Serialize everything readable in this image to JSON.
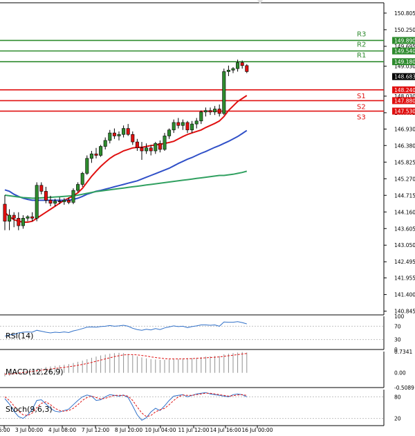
{
  "chart_data": {
    "type": "candlestick",
    "main": {
      "y_ticks": [
        "150.805",
        "150.250",
        "149.695",
        "149.030",
        "148.030",
        "147.475",
        "146.930",
        "146.380",
        "145.825",
        "145.270",
        "144.715",
        "144.160",
        "143.605",
        "143.050",
        "142.495",
        "141.955",
        "141.400",
        "140.845"
      ],
      "y_tick_values": [
        150.805,
        150.25,
        149.695,
        149.03,
        148.03,
        147.475,
        146.93,
        146.38,
        145.825,
        145.27,
        144.715,
        144.16,
        143.605,
        143.05,
        142.495,
        141.955,
        141.4,
        140.845
      ],
      "ylim": [
        140.72,
        151.15
      ],
      "x_ticks": [
        "6:00",
        "3 Jul 00:00",
        "4 Jul 08:00",
        "7 Jul 12:00",
        "8 Jul 20:00",
        "10 Jul 04:00",
        "11 Jul 12:00",
        "14 Jul 16:00",
        "16 Jul 00:00"
      ],
      "candles": [
        {
          "o": 144.42,
          "h": 144.72,
          "l": 143.55,
          "c": 143.85
        },
        {
          "o": 143.85,
          "h": 144.25,
          "l": 143.55,
          "c": 144.05
        },
        {
          "o": 144.05,
          "h": 144.15,
          "l": 143.65,
          "c": 143.95
        },
        {
          "o": 143.95,
          "h": 144.15,
          "l": 143.55,
          "c": 143.7
        },
        {
          "o": 143.7,
          "h": 144.05,
          "l": 143.6,
          "c": 143.95
        },
        {
          "o": 143.95,
          "h": 144.05,
          "l": 143.85,
          "c": 144.0
        },
        {
          "o": 144.0,
          "h": 144.15,
          "l": 143.85,
          "c": 143.95
        },
        {
          "o": 143.95,
          "h": 145.15,
          "l": 143.85,
          "c": 145.05
        },
        {
          "o": 145.05,
          "h": 145.15,
          "l": 144.75,
          "c": 144.85
        },
        {
          "o": 144.85,
          "h": 145.0,
          "l": 144.45,
          "c": 144.55
        },
        {
          "o": 144.55,
          "h": 144.7,
          "l": 144.35,
          "c": 144.45
        },
        {
          "o": 144.45,
          "h": 144.6,
          "l": 144.35,
          "c": 144.52
        },
        {
          "o": 144.52,
          "h": 144.65,
          "l": 144.42,
          "c": 144.5
        },
        {
          "o": 144.5,
          "h": 144.62,
          "l": 144.4,
          "c": 144.55
        },
        {
          "o": 144.55,
          "h": 144.65,
          "l": 144.42,
          "c": 144.48
        },
        {
          "o": 144.48,
          "h": 144.95,
          "l": 144.42,
          "c": 144.88
        },
        {
          "o": 144.88,
          "h": 145.15,
          "l": 144.82,
          "c": 145.08
        },
        {
          "o": 145.08,
          "h": 145.5,
          "l": 145.0,
          "c": 145.45
        },
        {
          "o": 145.45,
          "h": 146.05,
          "l": 145.4,
          "c": 145.95
        },
        {
          "o": 145.95,
          "h": 146.2,
          "l": 145.8,
          "c": 146.1
        },
        {
          "o": 146.1,
          "h": 146.3,
          "l": 145.95,
          "c": 146.05
        },
        {
          "o": 146.05,
          "h": 146.4,
          "l": 146.0,
          "c": 146.35
        },
        {
          "o": 146.35,
          "h": 146.65,
          "l": 146.25,
          "c": 146.55
        },
        {
          "o": 146.55,
          "h": 146.9,
          "l": 146.45,
          "c": 146.8
        },
        {
          "o": 146.8,
          "h": 146.95,
          "l": 146.6,
          "c": 146.7
        },
        {
          "o": 146.7,
          "h": 146.85,
          "l": 146.55,
          "c": 146.75
        },
        {
          "o": 146.75,
          "h": 147.05,
          "l": 146.65,
          "c": 146.95
        },
        {
          "o": 146.95,
          "h": 147.1,
          "l": 146.7,
          "c": 146.75
        },
        {
          "o": 146.75,
          "h": 146.85,
          "l": 146.4,
          "c": 146.5
        },
        {
          "o": 146.5,
          "h": 146.6,
          "l": 146.2,
          "c": 146.3
        },
        {
          "o": 146.3,
          "h": 146.5,
          "l": 145.9,
          "c": 146.2
        },
        {
          "o": 146.2,
          "h": 146.45,
          "l": 146.1,
          "c": 146.3
        },
        {
          "o": 146.3,
          "h": 146.4,
          "l": 146.05,
          "c": 146.2
        },
        {
          "o": 146.2,
          "h": 146.5,
          "l": 146.1,
          "c": 146.45
        },
        {
          "o": 146.45,
          "h": 146.55,
          "l": 146.15,
          "c": 146.25
        },
        {
          "o": 146.25,
          "h": 146.8,
          "l": 146.2,
          "c": 146.7
        },
        {
          "o": 146.7,
          "h": 146.95,
          "l": 146.6,
          "c": 146.9
        },
        {
          "o": 146.9,
          "h": 147.25,
          "l": 146.8,
          "c": 147.15
        },
        {
          "o": 147.15,
          "h": 147.3,
          "l": 146.95,
          "c": 147.05
        },
        {
          "o": 147.05,
          "h": 147.25,
          "l": 146.9,
          "c": 147.15
        },
        {
          "o": 147.15,
          "h": 147.2,
          "l": 146.8,
          "c": 146.9
        },
        {
          "o": 146.9,
          "h": 147.2,
          "l": 146.8,
          "c": 147.1
        },
        {
          "o": 147.1,
          "h": 147.3,
          "l": 146.95,
          "c": 147.2
        },
        {
          "o": 147.2,
          "h": 147.55,
          "l": 147.1,
          "c": 147.5
        },
        {
          "o": 147.5,
          "h": 147.65,
          "l": 147.35,
          "c": 147.55
        },
        {
          "o": 147.55,
          "h": 147.65,
          "l": 147.4,
          "c": 147.5
        },
        {
          "o": 147.5,
          "h": 147.7,
          "l": 147.4,
          "c": 147.6
        },
        {
          "o": 147.6,
          "h": 147.75,
          "l": 147.35,
          "c": 147.45
        },
        {
          "o": 147.45,
          "h": 148.95,
          "l": 147.4,
          "c": 148.85
        },
        {
          "o": 148.85,
          "h": 149.05,
          "l": 148.7,
          "c": 148.9
        },
        {
          "o": 148.9,
          "h": 149.0,
          "l": 148.8,
          "c": 148.95
        },
        {
          "o": 148.95,
          "h": 149.25,
          "l": 148.85,
          "c": 149.15
        },
        {
          "o": 149.15,
          "h": 149.22,
          "l": 148.95,
          "c": 149.05
        },
        {
          "o": 149.05,
          "h": 149.1,
          "l": 148.8,
          "c": 148.85
        }
      ],
      "moving_averages": [
        {
          "color": "#e01010",
          "values": [
            144.15,
            144.0,
            143.9,
            143.85,
            143.82,
            143.82,
            143.85,
            143.95,
            144.05,
            144.15,
            144.25,
            144.35,
            144.45,
            144.55,
            144.62,
            144.7,
            144.8,
            144.95,
            145.15,
            145.35,
            145.52,
            145.68,
            145.82,
            145.95,
            146.05,
            146.12,
            146.2,
            146.25,
            146.3,
            146.32,
            146.32,
            146.35,
            146.38,
            146.4,
            146.42,
            146.45,
            146.48,
            146.52,
            146.6,
            146.68,
            146.75,
            146.8,
            146.85,
            146.9,
            146.98,
            147.05,
            147.12,
            147.2,
            147.35,
            147.55,
            147.7,
            147.85,
            147.95,
            148.05
          ]
        },
        {
          "color": "#3050c8",
          "values": [
            144.9,
            144.85,
            144.75,
            144.68,
            144.62,
            144.58,
            144.55,
            144.55,
            144.55,
            144.55,
            144.55,
            144.55,
            144.55,
            144.55,
            144.55,
            144.58,
            144.62,
            144.68,
            144.75,
            144.8,
            144.85,
            144.88,
            144.92,
            144.96,
            145.0,
            145.04,
            145.08,
            145.12,
            145.16,
            145.2,
            145.26,
            145.32,
            145.38,
            145.44,
            145.5,
            145.56,
            145.62,
            145.7,
            145.78,
            145.85,
            145.92,
            145.98,
            146.05,
            146.12,
            146.18,
            146.25,
            146.32,
            146.38,
            146.45,
            146.52,
            146.6,
            146.68,
            146.78,
            146.88
          ]
        },
        {
          "color": "#30a060",
          "values": [
            144.72,
            144.7,
            144.68,
            144.66,
            144.64,
            144.63,
            144.62,
            144.62,
            144.63,
            144.64,
            144.65,
            144.66,
            144.67,
            144.68,
            144.69,
            144.7,
            144.72,
            144.75,
            144.78,
            144.81,
            144.84,
            144.86,
            144.88,
            144.9,
            144.92,
            144.94,
            144.96,
            144.98,
            145.0,
            145.02,
            145.04,
            145.06,
            145.08,
            145.1,
            145.12,
            145.14,
            145.16,
            145.18,
            145.2,
            145.22,
            145.24,
            145.26,
            145.28,
            145.3,
            145.32,
            145.34,
            145.36,
            145.38,
            145.38,
            145.4,
            145.42,
            145.45,
            145.48,
            145.52
          ]
        }
      ],
      "levels": [
        {
          "name": "R3",
          "value": "149.890",
          "y": 149.89,
          "color": "#2e8b2e"
        },
        {
          "name": "R2",
          "value": "149.540",
          "y": 149.54,
          "color": "#2e8b2e"
        },
        {
          "name": "R1",
          "value": "149.180",
          "y": 149.18,
          "color": "#2e8b2e"
        },
        {
          "name": "S1",
          "value": "148.240",
          "y": 148.24,
          "color": "#e01010"
        },
        {
          "name": "S2",
          "value": "147.880",
          "y": 147.88,
          "color": "#e01010"
        },
        {
          "name": "S3",
          "value": "147.530",
          "y": 147.53,
          "color": "#e01010"
        }
      ],
      "current_price": {
        "value": "148.683",
        "y": 148.683
      },
      "up_color": "#2e8b2e",
      "down_color": "#e01010"
    },
    "rsi": {
      "title": "RSI(14)",
      "y_ticks": [
        "100",
        "70",
        "30",
        "0"
      ],
      "y_tick_values": [
        100,
        70,
        30,
        0
      ],
      "ylim": [
        0,
        100
      ],
      "values": [
        40,
        44,
        45,
        50,
        52,
        53,
        52,
        58,
        55,
        52,
        50,
        52,
        51,
        53,
        51,
        56,
        59,
        63,
        67,
        68,
        67,
        69,
        70,
        72,
        70,
        71,
        73,
        70,
        64,
        60,
        58,
        61,
        59,
        63,
        60,
        65,
        68,
        71,
        69,
        70,
        66,
        69,
        71,
        74,
        74,
        73,
        74,
        70,
        83,
        82,
        82,
        84,
        81,
        77
      ],
      "color": "#3070c8"
    },
    "macd": {
      "title": "MACD(12,26,9)",
      "y_ticks": [
        "0.7341",
        "0.00",
        "-0.5089"
      ],
      "y_tick_values": [
        0.7341,
        0.0,
        -0.5089
      ],
      "ylim": [
        -0.5089,
        0.7341
      ],
      "histogram": [
        -0.12,
        -0.1,
        -0.05,
        0.0,
        0.03,
        0.06,
        0.09,
        0.12,
        0.16,
        0.2,
        0.22,
        0.24,
        0.26,
        0.28,
        0.3,
        0.34,
        0.38,
        0.42,
        0.47,
        0.52,
        0.56,
        0.6,
        0.63,
        0.66,
        0.68,
        0.69,
        0.68,
        0.65,
        0.61,
        0.57,
        0.53,
        0.5,
        0.47,
        0.46,
        0.45,
        0.45,
        0.46,
        0.47,
        0.48,
        0.5,
        0.5,
        0.51,
        0.52,
        0.54,
        0.56,
        0.57,
        0.58,
        0.58,
        0.64,
        0.66,
        0.68,
        0.7,
        0.72,
        0.7
      ],
      "signal": [
        -0.05,
        -0.04,
        -0.03,
        -0.01,
        0.01,
        0.03,
        0.05,
        0.07,
        0.09,
        0.11,
        0.13,
        0.15,
        0.17,
        0.19,
        0.21,
        0.23,
        0.26,
        0.29,
        0.32,
        0.36,
        0.4,
        0.44,
        0.48,
        0.52,
        0.56,
        0.59,
        0.62,
        0.63,
        0.63,
        0.62,
        0.6,
        0.58,
        0.55,
        0.53,
        0.51,
        0.49,
        0.48,
        0.48,
        0.48,
        0.48,
        0.49,
        0.49,
        0.5,
        0.51,
        0.52,
        0.53,
        0.54,
        0.55,
        0.57,
        0.59,
        0.61,
        0.63,
        0.65,
        0.67
      ],
      "hist_color": "#909090",
      "signal_color": "#e01010"
    },
    "stoch": {
      "title": "Stoch(9,6,3)",
      "y_ticks": [
        "80",
        "20"
      ],
      "y_tick_values": [
        80,
        20
      ],
      "ylim": [
        0,
        100
      ],
      "k": [
        75,
        60,
        40,
        25,
        20,
        30,
        45,
        70,
        72,
        60,
        48,
        40,
        38,
        42,
        46,
        58,
        70,
        80,
        85,
        82,
        70,
        72,
        80,
        86,
        84,
        82,
        85,
        78,
        55,
        30,
        15,
        22,
        38,
        48,
        42,
        55,
        70,
        82,
        84,
        86,
        80,
        84,
        88,
        90,
        92,
        88,
        86,
        84,
        82,
        80,
        86,
        88,
        86,
        80
      ],
      "d": [
        80,
        70,
        55,
        40,
        30,
        28,
        35,
        50,
        62,
        66,
        58,
        48,
        42,
        40,
        42,
        48,
        58,
        70,
        78,
        82,
        78,
        74,
        76,
        80,
        84,
        84,
        84,
        82,
        70,
        52,
        35,
        25,
        28,
        38,
        44,
        48,
        58,
        70,
        80,
        85,
        84,
        84,
        86,
        88,
        90,
        90,
        88,
        86,
        84,
        82,
        83,
        85,
        86,
        84
      ],
      "k_color": "#3070c8",
      "d_color": "#e01010"
    },
    "x_labels_bottom": [
      "6:00",
      "3 Jul 00:00",
      "4 Jul 08:00",
      "7 Jul 12:00",
      "8 Jul 20:00",
      "10 Jul 04:00",
      "11 Jul 12:00",
      "14 Jul 16:00",
      "16 Jul 00:00"
    ]
  }
}
